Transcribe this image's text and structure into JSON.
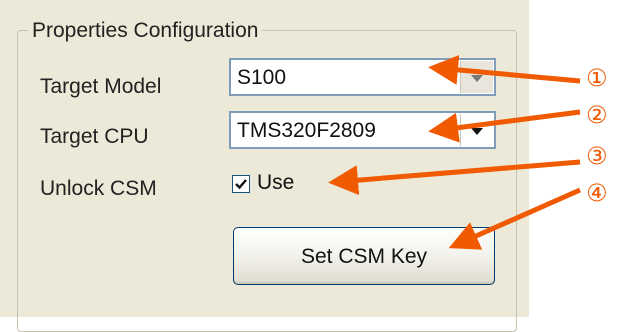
{
  "group": {
    "title": "Properties Configuration"
  },
  "fields": {
    "target_model": {
      "label": "Target Model",
      "value": "S100"
    },
    "target_cpu": {
      "label": "Target CPU",
      "value": "TMS320F2809"
    },
    "unlock_csm": {
      "label": "Unlock CSM",
      "checkbox_label": "Use",
      "checked": true
    }
  },
  "buttons": {
    "set_csm_key": "Set CSM Key"
  },
  "annotations": {
    "markers": [
      "①",
      "②",
      "③",
      "④"
    ],
    "arrow_color": "#f05a00"
  }
}
